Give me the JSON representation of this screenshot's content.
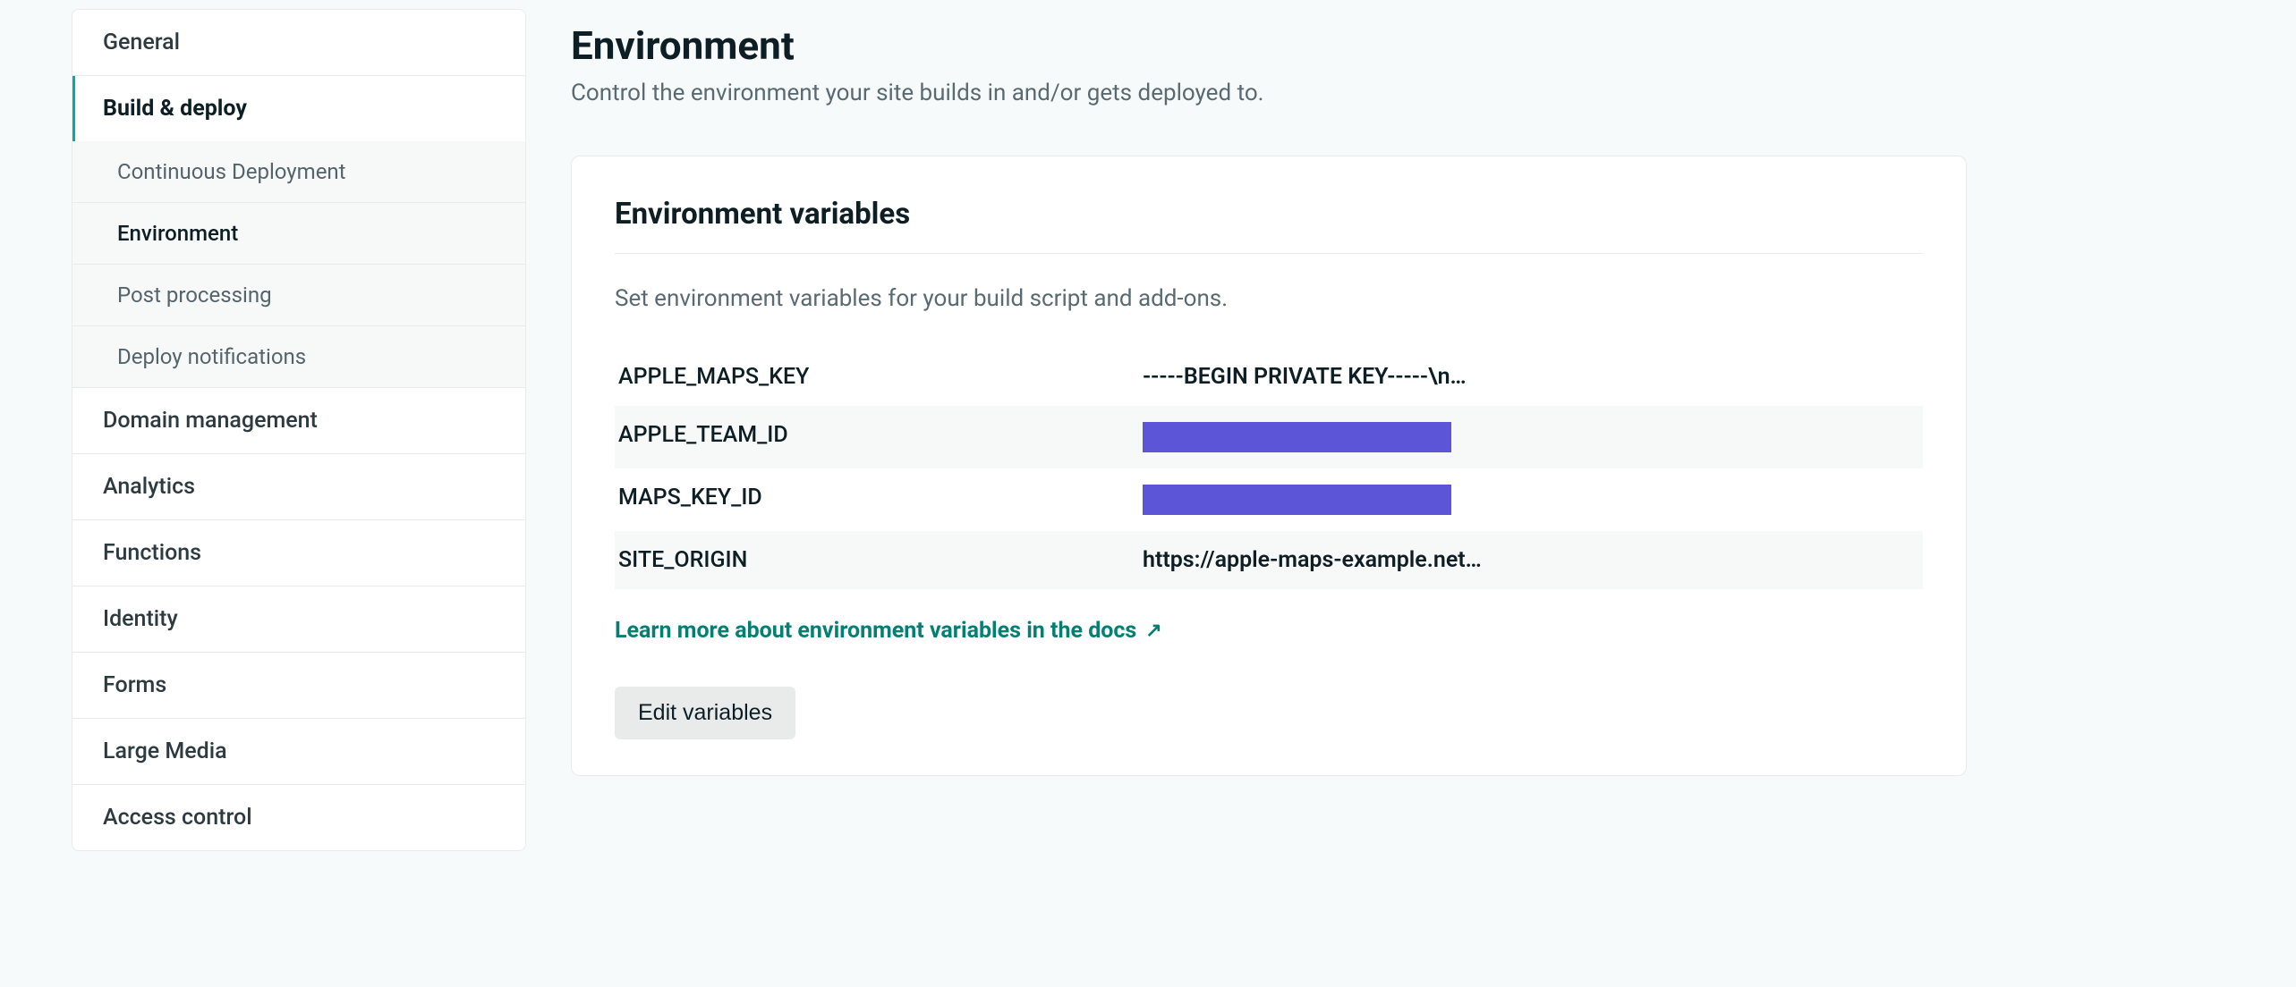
{
  "sidebar": {
    "items": [
      {
        "label": "General",
        "active": false
      },
      {
        "label": "Build & deploy",
        "active": true,
        "subitems": [
          {
            "label": "Continuous Deployment",
            "current": false
          },
          {
            "label": "Environment",
            "current": true
          },
          {
            "label": "Post processing",
            "current": false
          },
          {
            "label": "Deploy notifications",
            "current": false
          }
        ]
      },
      {
        "label": "Domain management",
        "active": false
      },
      {
        "label": "Analytics",
        "active": false
      },
      {
        "label": "Functions",
        "active": false
      },
      {
        "label": "Identity",
        "active": false
      },
      {
        "label": "Forms",
        "active": false
      },
      {
        "label": "Large Media",
        "active": false
      },
      {
        "label": "Access control",
        "active": false
      }
    ]
  },
  "page": {
    "title": "Environment",
    "subtitle": "Control the environment your site builds in and/or gets deployed to."
  },
  "card": {
    "title": "Environment variables",
    "description": "Set environment variables for your build script and add-ons.",
    "env_vars": [
      {
        "key": "APPLE_MAPS_KEY",
        "value": "-----BEGIN PRIVATE KEY-----\\n…",
        "redacted": false
      },
      {
        "key": "APPLE_TEAM_ID",
        "value": "",
        "redacted": true
      },
      {
        "key": "MAPS_KEY_ID",
        "value": "",
        "redacted": true
      },
      {
        "key": "SITE_ORIGIN",
        "value": "https://apple-maps-example.net…",
        "redacted": false
      }
    ],
    "docs_link_text": "Learn more about environment variables in the docs",
    "edit_button_label": "Edit variables"
  }
}
